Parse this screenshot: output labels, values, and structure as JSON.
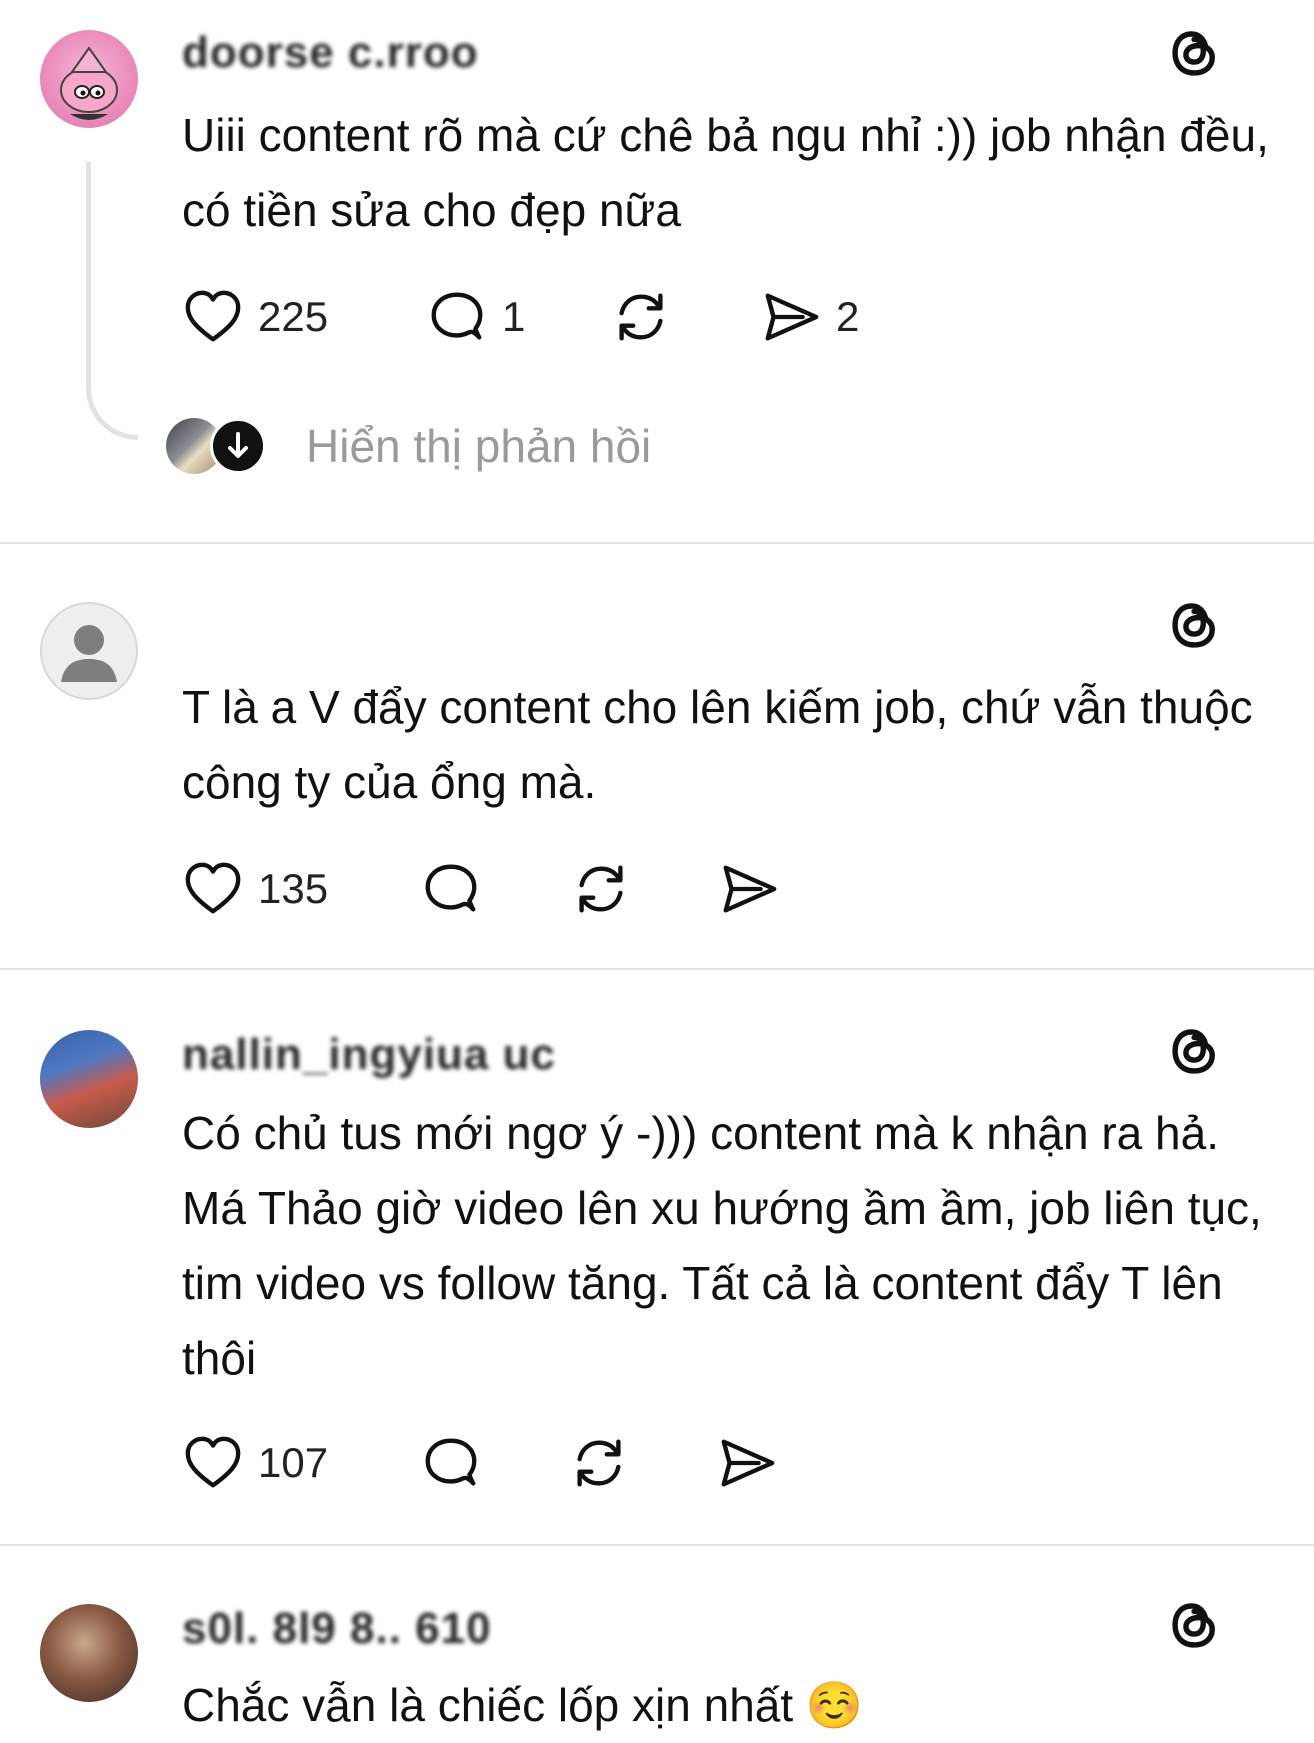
{
  "posts": [
    {
      "username": "doorse c.rroo",
      "text": "Uiii content rõ mà cứ chê bả ngu nhỉ :)) job nhận đều, có tiền sửa cho đẹp nữa",
      "likes": "225",
      "comments": "1",
      "shares": "2",
      "show_replies": "Hiển thị phản hồi"
    },
    {
      "username": "",
      "text": "T là a V đẩy content cho lên kiếm job, chứ vẫn thuộc công ty của ổng mà.",
      "likes": "135"
    },
    {
      "username": "nallin_ingyiua uc",
      "text": "Có chủ tus mới ngơ ý -))) content mà k nhận ra hả. Má Thảo giờ video lên xu hướng ầm ầm, job liên tục, tim video vs follow tăng. Tất cả là content đẩy T lên thôi",
      "likes": "107"
    },
    {
      "username": "s0l. 8l9 8.. 610",
      "text": "Chắc vẫn là chiếc lốp xịn nhất ☺️"
    }
  ],
  "icons": {
    "like": "heart-icon",
    "comment": "comment-bubble-icon",
    "repost": "repost-icon",
    "share": "send-icon",
    "threads": "threads-logo-icon",
    "down_arrow": "arrow-down-icon"
  },
  "colors": {
    "text": "#111111",
    "muted": "#9a9a9a",
    "divider": "#e3e3e3"
  }
}
